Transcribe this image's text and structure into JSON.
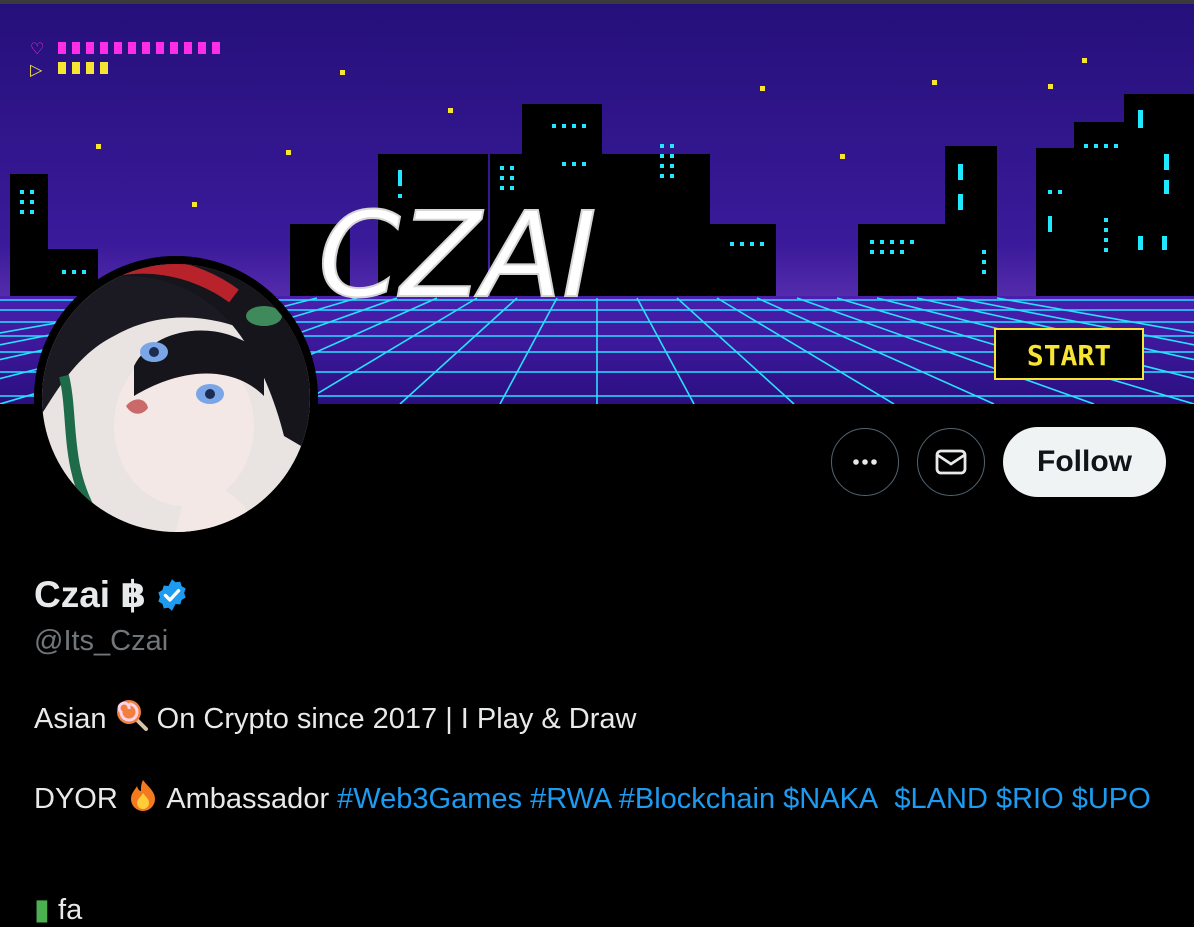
{
  "banner": {
    "title": "CZAI",
    "start_label": "START",
    "hud_heart": "♡",
    "hud_play": "▷"
  },
  "actions": {
    "more_icon": "more-icon",
    "message_icon": "mail-icon",
    "follow_label": "Follow"
  },
  "profile": {
    "name": "Czai ฿",
    "handle": "@Its_Czai",
    "verified": true
  },
  "bio": {
    "line1_a": "Asian ",
    "line1_emoji": "lollipop",
    "line1_b": " On Crypto since 2017 | I Play & Draw",
    "line2_a": "DYOR ",
    "line2_emoji": "fire",
    "line2_b": " Ambassador ",
    "tags": [
      "#Web3Games",
      "#RWA",
      "#Blockchain",
      "$NAKA",
      "$LAND",
      "$RIO",
      "$UPO"
    ],
    "line3_partial": "fa"
  },
  "colors": {
    "accent": "#1d9bf0",
    "banner_sky": "#2d1277",
    "grid_cyan": "#29e0ff",
    "start_yellow": "#f7e533"
  }
}
